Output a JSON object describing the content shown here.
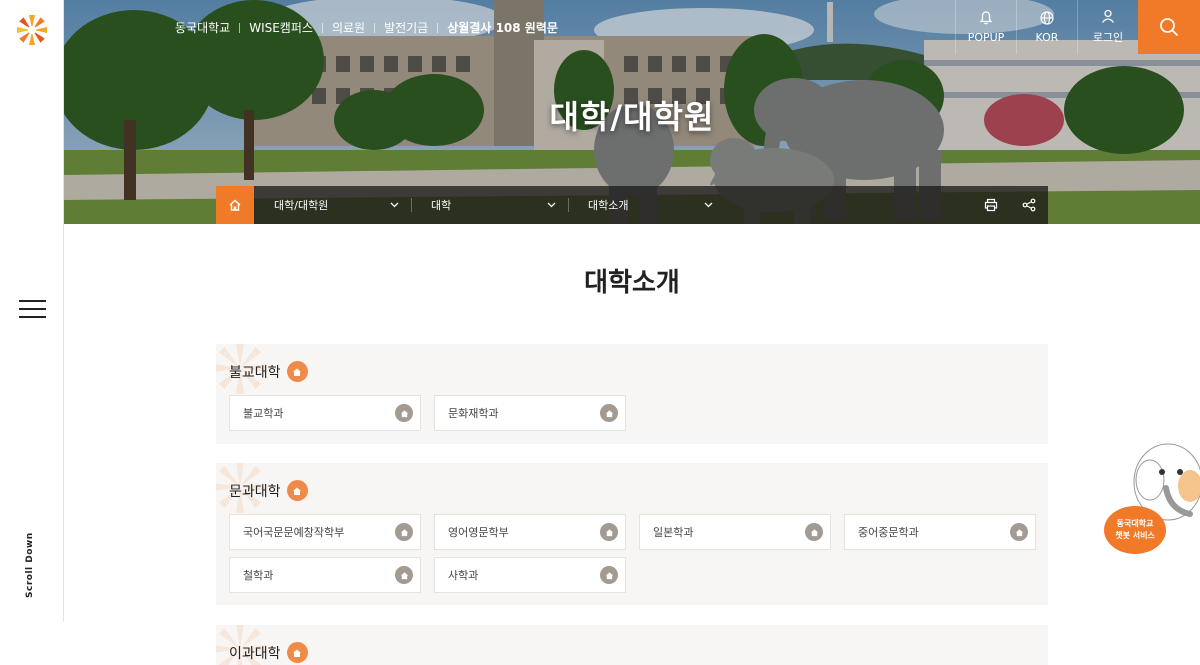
{
  "colors": {
    "accent": "#f07a28",
    "section_bg": "#f8f6f4",
    "badge_gray": "#a39b92"
  },
  "header": {
    "top_links": [
      "동국대학교",
      "WISE캠퍼스",
      "의료원",
      "발전기금",
      "상월결사 108 원력문"
    ],
    "util": {
      "popup_label": "POPUP",
      "lang_label": "KOR",
      "login_label": "로그인"
    },
    "hero_title": "대학/대학원"
  },
  "breadcrumb": {
    "level1": "대학/대학원",
    "level2": "대학",
    "level3": "대학소개"
  },
  "sidebar": {
    "scroll_label": "Scroll Down"
  },
  "main": {
    "title": "대학소개",
    "sections": [
      {
        "name": "불교대학",
        "departments": [
          "불교학과",
          "문화재학과"
        ]
      },
      {
        "name": "문과대학",
        "departments": [
          "국어국문문예창작학부",
          "영어영문학부",
          "일본학과",
          "중어중문학과",
          "철학과",
          "사학과"
        ]
      },
      {
        "name": "이과대학",
        "departments": []
      }
    ]
  },
  "chatbot": {
    "line1": "동국대학교",
    "line2": "챗봇 서비스"
  },
  "icons": [
    "logo-icon",
    "bell-icon",
    "globe-icon",
    "user-icon",
    "search-icon",
    "home-icon",
    "chevron-down-icon",
    "print-icon",
    "share-icon",
    "menu-icon"
  ]
}
